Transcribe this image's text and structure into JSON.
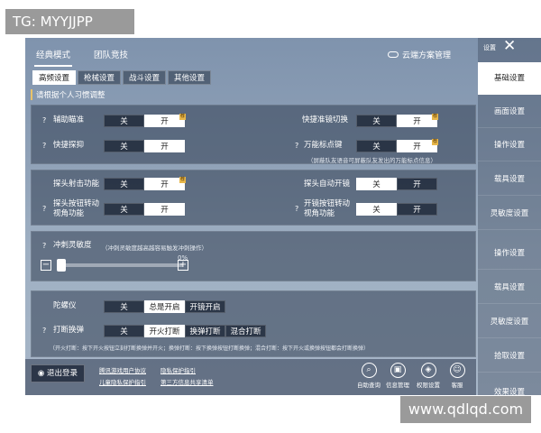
{
  "watermarks": {
    "top": "TG: MYYJJPP",
    "bottom": "www.qdlqd.com"
  },
  "header": {
    "tabs": [
      {
        "label": "经典模式"
      },
      {
        "label": "团队竞技"
      }
    ],
    "cloud_label": "云端方案管理"
  },
  "subtabs": [
    {
      "label": "高频设置"
    },
    {
      "label": "枪械设置"
    },
    {
      "label": "战斗设置"
    },
    {
      "label": "其他设置"
    }
  ],
  "hint": "请根据个人习惯调整",
  "common": {
    "off": "关",
    "on": "开",
    "badge": "荐"
  },
  "panel1": {
    "aim_assist": "辅助瞄准",
    "quick_lean": "快捷探抑",
    "quick_scope_switch": "快捷准镜切换",
    "universal_mark": "万能标点键",
    "universal_mark_note": "（屏蔽队友语音可屏蔽队友发出的万能标点信息）"
  },
  "panel2": {
    "lean_fire": "探头射击功能",
    "lean_auto_scope": "探头自动开镜",
    "lean_button_turn": "探头按钮转动",
    "lean_button_turn2": "视角功能",
    "scope_button_turn": "开镜按钮转动",
    "scope_button_turn2": "视角功能"
  },
  "panel3": {
    "sprint_sensitivity": "冲刺灵敏度",
    "sprint_note": "（冲刺灵敏度越高越容易触发冲刺操作）",
    "value_label": "0%",
    "value": 0.0
  },
  "panel4": {
    "gyro": "陀螺仪",
    "gyro_options": [
      "关",
      "总是开启",
      "开镜开启"
    ],
    "interrupt_reload": "打断换弹",
    "interrupt_options": [
      "关",
      "开火打断",
      "换弹打断",
      "混合打断"
    ],
    "interrupt_note": "（开火打断：按下开火按钮立刻打断换弹并开火；换弹打断：按下换弹按钮打断换弹；混合打断：按下开火或换弹按钮都会打断换弹）"
  },
  "bottom": {
    "logout": "退出登录",
    "links": [
      "腾讯游戏用户协议",
      "隐私保护指引",
      "儿童隐私保护指引",
      "第三方信息共享清单"
    ],
    "icons": [
      {
        "label": "自助查询",
        "icon": "search-icon"
      },
      {
        "label": "信息管理",
        "icon": "id-card-icon"
      },
      {
        "label": "权限设置",
        "icon": "shield-icon"
      },
      {
        "label": "客服",
        "icon": "headset-icon"
      }
    ]
  },
  "sidebar": {
    "title": "设置",
    "items": [
      {
        "label": "基础设置"
      },
      {
        "label": "画面设置"
      },
      {
        "label": "操作设置"
      },
      {
        "label": "载具设置"
      },
      {
        "label": "灵敏度设置"
      },
      {
        "label": "操作设置"
      },
      {
        "label": "载具设置"
      },
      {
        "label": "灵敏度设置"
      },
      {
        "label": "拾取设置"
      },
      {
        "label": "效果设置"
      }
    ]
  }
}
